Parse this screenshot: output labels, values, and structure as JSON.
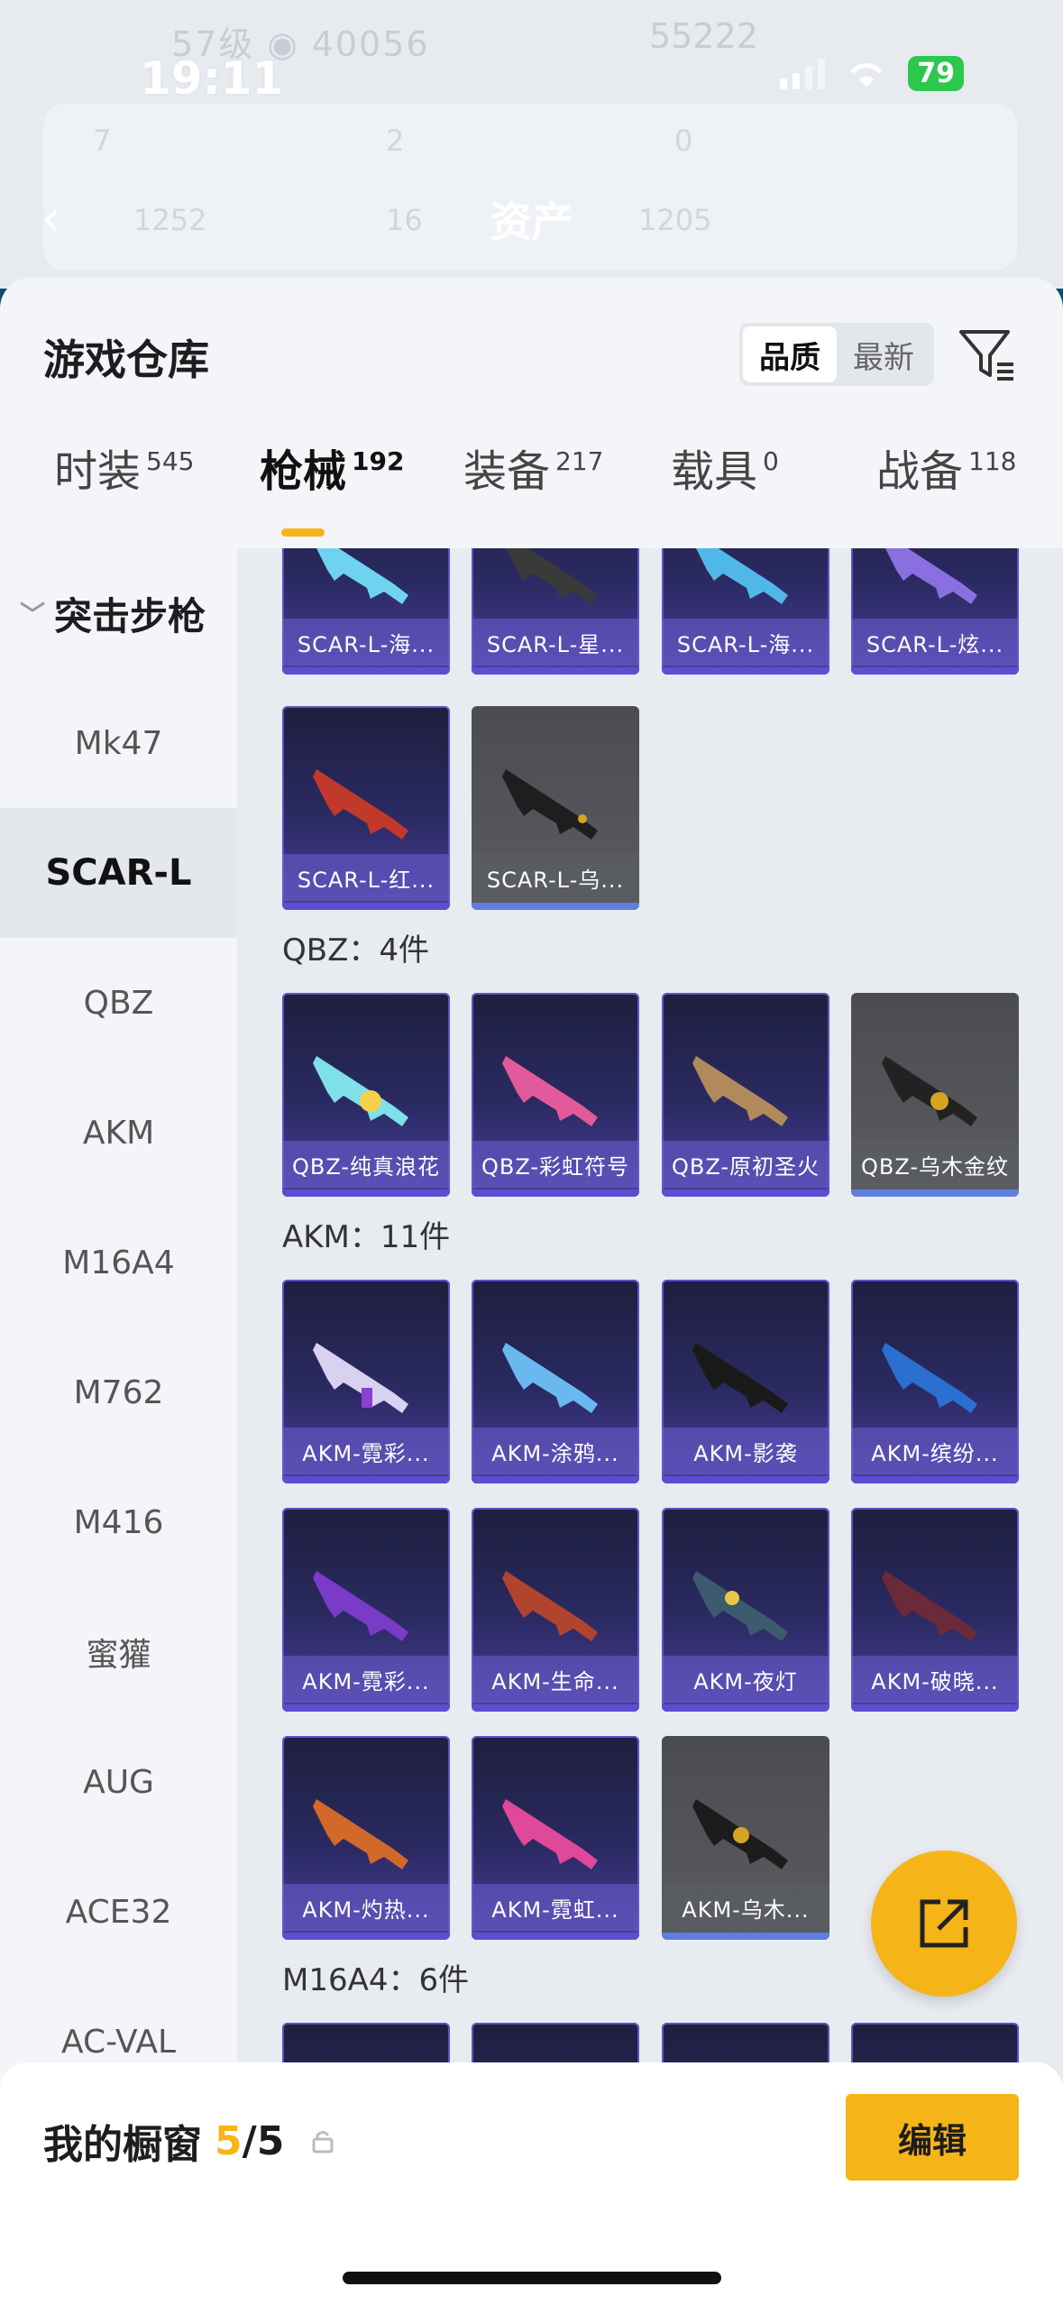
{
  "status": {
    "time": "19:11",
    "battery": "79"
  },
  "background": {
    "level_text": "57级",
    "views_text": "40056",
    "score_text": "55222",
    "title": "资产",
    "stats": [
      "7",
      "2",
      "0",
      "1252",
      "16",
      "1205"
    ]
  },
  "sheet": {
    "title": "游戏仓库",
    "sort_options": [
      {
        "label": "品质",
        "active": true
      },
      {
        "label": "最新",
        "active": false
      }
    ],
    "filter_icon": "filter-icon"
  },
  "tabs": [
    {
      "label": "时装",
      "count": "545"
    },
    {
      "label": "枪械",
      "count": "192",
      "active": true
    },
    {
      "label": "装备",
      "count": "217"
    },
    {
      "label": "载具",
      "count": "0"
    },
    {
      "label": "战备",
      "count": "118"
    }
  ],
  "categories": {
    "group": "突击步枪",
    "items": [
      "Mk47",
      "SCAR-L",
      "QBZ",
      "AKM",
      "M16A4",
      "M762",
      "M416",
      "蜜獾",
      "AUG",
      "ACE32",
      "AC-VAL"
    ],
    "active": "SCAR-L"
  },
  "grid": {
    "scar_row1": [
      "SCAR-L-海...",
      "SCAR-L-星...",
      "SCAR-L-海...",
      "SCAR-L-炫..."
    ],
    "scar_row2": [
      "SCAR-L-红...",
      "SCAR-L-乌..."
    ],
    "qbz_label": "QBZ：4件",
    "qbz": [
      "QBZ-纯真浪花",
      "QBZ-彩虹符号",
      "QBZ-原初圣火",
      "QBZ-乌木金纹"
    ],
    "akm_label": "AKM：11件",
    "akm_row1": [
      "AKM-霓彩...",
      "AKM-涂鸦...",
      "AKM-影袭",
      "AKM-缤纷..."
    ],
    "akm_row2": [
      "AKM-霓彩...",
      "AKM-生命...",
      "AKM-夜灯",
      "AKM-破晓..."
    ],
    "akm_row3": [
      "AKM-灼热...",
      "AKM-霓虹...",
      "AKM-乌木..."
    ],
    "m16_label": "M16A4：6件"
  },
  "bottom": {
    "showcase_label": "我的橱窗",
    "showcase_count": "5",
    "showcase_total": "/5",
    "edit_label": "编辑"
  }
}
